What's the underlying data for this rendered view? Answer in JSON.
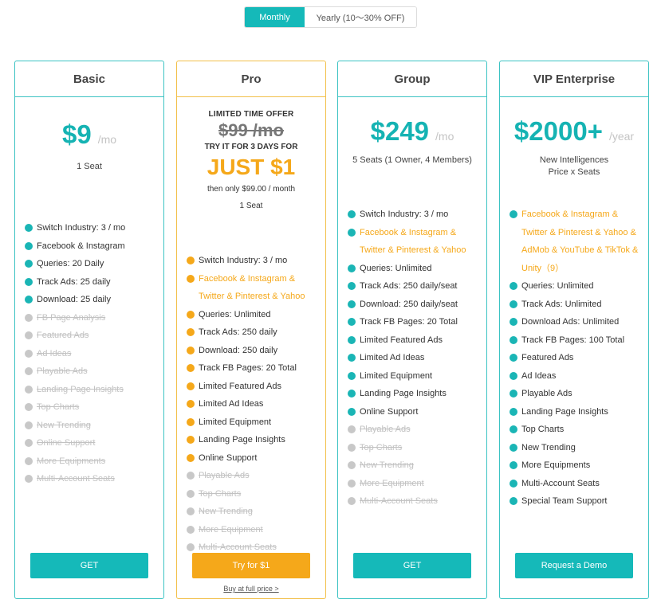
{
  "billing_toggle": {
    "monthly": "Monthly",
    "yearly": "Yearly (10～30% OFF)",
    "selected": "Monthly"
  },
  "colors": {
    "teal": "#15b9b9",
    "orange": "#f5a81a",
    "disabled": "#c2c2c2"
  },
  "plans": [
    {
      "name": "Basic",
      "price": "$9",
      "period": "/mo",
      "seats": "1 Seat",
      "features": [
        {
          "label": "Switch Industry: 3 / mo",
          "state": "on"
        },
        {
          "label": "Facebook & Instagram",
          "state": "on"
        },
        {
          "label": "Queries: 20 Daily",
          "state": "on"
        },
        {
          "label": "Track Ads: 25 daily",
          "state": "on"
        },
        {
          "label": "Download: 25 daily",
          "state": "on"
        },
        {
          "label": "FB Page Analysis",
          "state": "off"
        },
        {
          "label": "Featured Ads",
          "state": "off"
        },
        {
          "label": "Ad Ideas",
          "state": "off"
        },
        {
          "label": "Playable Ads",
          "state": "off"
        },
        {
          "label": "Landing Page Insights",
          "state": "off"
        },
        {
          "label": "Top Charts",
          "state": "off"
        },
        {
          "label": "New Trending",
          "state": "off"
        },
        {
          "label": "Online Support",
          "state": "off"
        },
        {
          "label": "More Equipments",
          "state": "off"
        },
        {
          "label": "Multi-Account Seats",
          "state": "off"
        }
      ],
      "button": "GET"
    },
    {
      "name": "Pro",
      "offer_label": "LIMITED TIME OFFER",
      "old_price": "$99 /mo",
      "try_label": "TRY IT FOR 3 DAYS FOR",
      "promo_price": "JUST $1",
      "then_label": "then only $99.00 / month",
      "seats": "1 Seat",
      "features": [
        {
          "label": "Switch Industry: 3 / mo",
          "state": "on"
        },
        {
          "label": "Facebook & Instagram & Twitter & Pinterest & Yahoo",
          "state": "hl"
        },
        {
          "label": "Queries: Unlimited",
          "state": "on"
        },
        {
          "label": "Track Ads: 250 daily",
          "state": "on"
        },
        {
          "label": "Download: 250 daily",
          "state": "on"
        },
        {
          "label": "Track FB Pages: 20 Total",
          "state": "on"
        },
        {
          "label": "Limited Featured Ads",
          "state": "on"
        },
        {
          "label": "Limited Ad Ideas",
          "state": "on"
        },
        {
          "label": "Limited Equipment",
          "state": "on"
        },
        {
          "label": "Landing Page Insights",
          "state": "on"
        },
        {
          "label": "Online Support",
          "state": "on"
        },
        {
          "label": "Playable Ads",
          "state": "off"
        },
        {
          "label": "Top Charts",
          "state": "off"
        },
        {
          "label": "New Trending",
          "state": "off"
        },
        {
          "label": "More Equipment",
          "state": "off"
        },
        {
          "label": "Multi-Account Seats",
          "state": "off"
        }
      ],
      "button": "Try for $1",
      "full_price_link": "Buy at full price >"
    },
    {
      "name": "Group",
      "price": "$249",
      "period": "/mo",
      "seats": "5 Seats (1 Owner, 4 Members)",
      "features": [
        {
          "label": "Switch Industry: 3 / mo",
          "state": "on"
        },
        {
          "label": "Facebook & Instagram & Twitter & Pinterest & Yahoo",
          "state": "hl"
        },
        {
          "label": "Queries: Unlimited",
          "state": "on"
        },
        {
          "label": "Track Ads: 250 daily/seat",
          "state": "on"
        },
        {
          "label": "Download: 250 daily/seat",
          "state": "on"
        },
        {
          "label": "Track FB Pages: 20 Total",
          "state": "on"
        },
        {
          "label": "Limited Featured Ads",
          "state": "on"
        },
        {
          "label": "Limited Ad Ideas",
          "state": "on"
        },
        {
          "label": "Limited Equipment",
          "state": "on"
        },
        {
          "label": "Landing Page Insights",
          "state": "on"
        },
        {
          "label": "Online Support",
          "state": "on"
        },
        {
          "label": "Playable Ads",
          "state": "off"
        },
        {
          "label": "Top Charts",
          "state": "off"
        },
        {
          "label": "New Trending",
          "state": "off"
        },
        {
          "label": "More Equipment",
          "state": "off"
        },
        {
          "label": "Multi-Account Seats",
          "state": "off"
        }
      ],
      "button": "GET"
    },
    {
      "name": "VIP Enterprise",
      "price": "$2000+",
      "period": "/year",
      "seats": "New Intelligences Price x Seats",
      "features": [
        {
          "label": "Facebook & Instagram & Twitter & Pinterest & Yahoo & AdMob & YouTube & TikTok & Unity（9）",
          "state": "hl"
        },
        {
          "label": "Queries: Unlimited",
          "state": "on"
        },
        {
          "label": "Track Ads: Unlimited",
          "state": "on"
        },
        {
          "label": "Download Ads: Unlimited",
          "state": "on"
        },
        {
          "label": "Track FB Pages: 100 Total",
          "state": "on"
        },
        {
          "label": "Featured Ads",
          "state": "on"
        },
        {
          "label": "Ad Ideas",
          "state": "on"
        },
        {
          "label": "Playable Ads",
          "state": "on"
        },
        {
          "label": "Landing Page Insights",
          "state": "on"
        },
        {
          "label": "Top Charts",
          "state": "on"
        },
        {
          "label": "New Trending",
          "state": "on"
        },
        {
          "label": "More Equipments",
          "state": "on"
        },
        {
          "label": "Multi-Account Seats",
          "state": "on"
        },
        {
          "label": "Special Team Support",
          "state": "on"
        }
      ],
      "button": "Request a Demo"
    }
  ]
}
